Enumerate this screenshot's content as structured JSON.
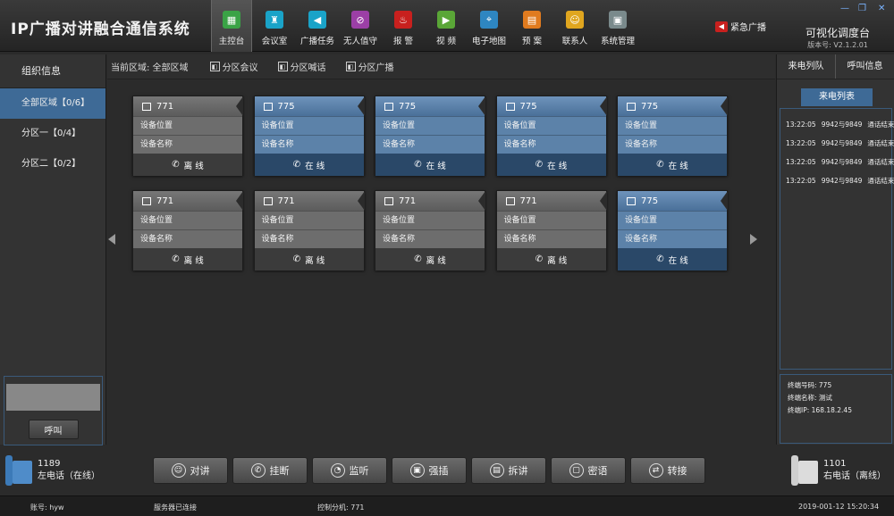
{
  "app_title": "IP广播对讲融合通信系统",
  "nav": [
    {
      "label": "主控台",
      "icon": "dashboard-icon",
      "color": "#3aa346",
      "glyph": "▦"
    },
    {
      "label": "会议室",
      "icon": "meeting-icon",
      "color": "#1aa3c8",
      "glyph": "♜"
    },
    {
      "label": "广播任务",
      "icon": "broadcast-icon",
      "color": "#1aa3c8",
      "glyph": "◀"
    },
    {
      "label": "无人值守",
      "icon": "unattended-icon",
      "color": "#9b3fa6",
      "glyph": "⊘"
    },
    {
      "label": "报 警",
      "icon": "alarm-icon",
      "color": "#c8201e",
      "glyph": "♨"
    },
    {
      "label": "视 频",
      "icon": "video-icon",
      "color": "#5aa637",
      "glyph": "▶"
    },
    {
      "label": "电子地图",
      "icon": "map-icon",
      "color": "#2e86c1",
      "glyph": "⌖"
    },
    {
      "label": "预 案",
      "icon": "plan-icon",
      "color": "#e07b1f",
      "glyph": "▤"
    },
    {
      "label": "联系人",
      "icon": "contacts-icon",
      "color": "#e0a61f",
      "glyph": "☺"
    },
    {
      "label": "系统管理",
      "icon": "settings-icon",
      "color": "#7a8a8c",
      "glyph": "▣"
    }
  ],
  "emergency_label": "紧急广播",
  "brand": "可视化调度台",
  "version": "版本号: V2.1.2.01",
  "left_panel": {
    "title": "组织信息",
    "areas": [
      "全部区域【0/6】",
      "分区一【0/4】",
      "分区二【0/2】"
    ],
    "call_button": "呼叫"
  },
  "toolbar": {
    "current_area": "当前区域: 全部区域",
    "btn1": "分区会议",
    "btn2": "分区喊话",
    "btn3": "分区广播"
  },
  "card_labels": {
    "location": "设备位置",
    "name": "设备名称"
  },
  "devices": [
    {
      "id": "771",
      "status": "离 线",
      "online": false
    },
    {
      "id": "775",
      "status": "在 线",
      "online": true
    },
    {
      "id": "775",
      "status": "在 线",
      "online": true
    },
    {
      "id": "775",
      "status": "在 线",
      "online": true
    },
    {
      "id": "775",
      "status": "在 线",
      "online": true
    },
    {
      "id": "771",
      "status": "离 线",
      "online": false
    },
    {
      "id": "771",
      "status": "离 线",
      "online": false
    },
    {
      "id": "771",
      "status": "离 线",
      "online": false
    },
    {
      "id": "771",
      "status": "离 线",
      "online": false
    },
    {
      "id": "775",
      "status": "在 线",
      "online": true
    }
  ],
  "right_panel": {
    "tab1": "来电列队",
    "tab2": "呼叫信息",
    "list_title": "来电列表",
    "logs": [
      {
        "time": "13:22:05",
        "pair": "9942与9849",
        "state": "通话结束"
      },
      {
        "time": "13:22:05",
        "pair": "9942与9849",
        "state": "通话结束"
      },
      {
        "time": "13:22:05",
        "pair": "9942与9849",
        "state": "通话结束"
      },
      {
        "time": "13:22:05",
        "pair": "9942与9849",
        "state": "通话结束"
      }
    ],
    "info": {
      "number": "终端号码: 775",
      "name": "终端名称: 测试",
      "ip": "终端IP: 168.18.2.45"
    }
  },
  "phone_left": {
    "number": "1189",
    "label": "左电话（在线）"
  },
  "phone_right": {
    "number": "1101",
    "label": "右电话（离线）"
  },
  "actions": [
    {
      "label": "对讲",
      "icon": "intercom-icon",
      "glyph": "☺"
    },
    {
      "label": "挂断",
      "icon": "hangup-icon",
      "glyph": "✆"
    },
    {
      "label": "监听",
      "icon": "listen-icon",
      "glyph": "◔"
    },
    {
      "label": "强插",
      "icon": "force-insert-icon",
      "glyph": "▣"
    },
    {
      "label": "拆讲",
      "icon": "split-icon",
      "glyph": "▤"
    },
    {
      "label": "密语",
      "icon": "whisper-icon",
      "glyph": "▢"
    },
    {
      "label": "转接",
      "icon": "transfer-icon",
      "glyph": "⇄"
    }
  ],
  "status_bar": {
    "account": "账号: hyw",
    "server": "服务器已连接",
    "extension": "控制分机: 771",
    "datetime": "2019-001-12   15:20:34"
  }
}
